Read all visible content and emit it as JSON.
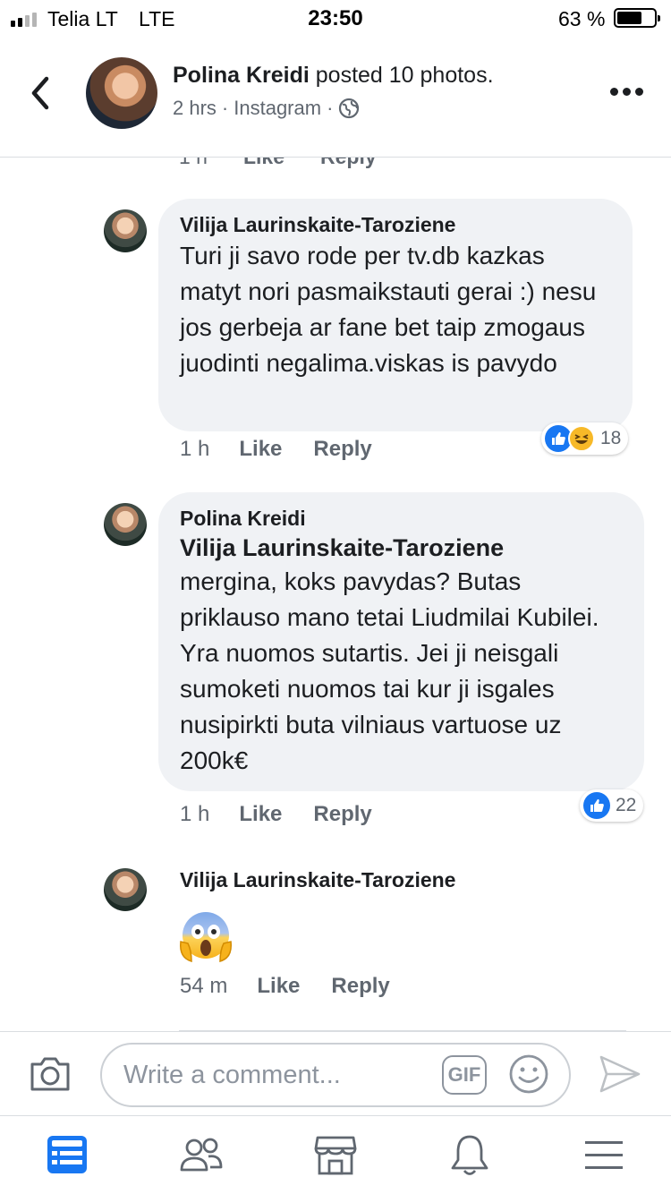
{
  "status_bar": {
    "carrier": "Telia LT",
    "network": "LTE",
    "time": "23:50",
    "battery_percent": "63 %"
  },
  "header": {
    "author": "Polina Kreidi",
    "action": "posted 10 photos.",
    "age": "2 hrs",
    "source": "Instagram",
    "separator": "·",
    "privacy_icon": "globe-icon"
  },
  "cut_comment": {
    "time": "1 h",
    "like_label": "Like",
    "reply_label": "Reply"
  },
  "comments": [
    {
      "author": "Vilija Laurinskaite-Taroziene",
      "text": "Turi ji savo rode per tv.db kazkas matyt nori pasmaikstauti gerai :) nesu jos gerbeja ar fane bet taip zmogaus juodinti negalima.viskas is pavydo",
      "time": "1 h",
      "like_label": "Like",
      "reply_label": "Reply",
      "reaction_count": "18",
      "reactions": [
        "like-reaction-icon",
        "haha-reaction-icon"
      ]
    },
    {
      "author": "Polina Kreidi",
      "mention": "Vilija Laurinskaite-Taroziene",
      "text": "mergina, koks pavydas? Butas priklauso mano tetai Liudmilai Kubilei. Yra nuomos sutartis. Jei ji neisgali sumoketi nuomos tai kur ji isgales nusipirkti buta vilniaus vartuose uz 200k€",
      "time": "1 h",
      "like_label": "Like",
      "reply_label": "Reply",
      "reaction_count": "22",
      "reactions": [
        "like-reaction-icon"
      ]
    },
    {
      "author": "Vilija Laurinskaite-Taroziene",
      "emoji": "face-screaming-in-fear",
      "time": "54 m",
      "like_label": "Like",
      "reply_label": "Reply"
    }
  ],
  "composer": {
    "placeholder": "Write a comment...",
    "gif_label": "GIF",
    "icons": [
      "camera-icon",
      "gif-icon",
      "smiley-icon",
      "send-icon"
    ]
  },
  "bottom_nav": {
    "items": [
      "news-feed-icon",
      "friends-icon",
      "marketplace-icon",
      "notifications-icon",
      "menu-icon"
    ],
    "active": "news-feed-icon",
    "active_color": "#1877f2",
    "inactive_color": "#606770"
  }
}
